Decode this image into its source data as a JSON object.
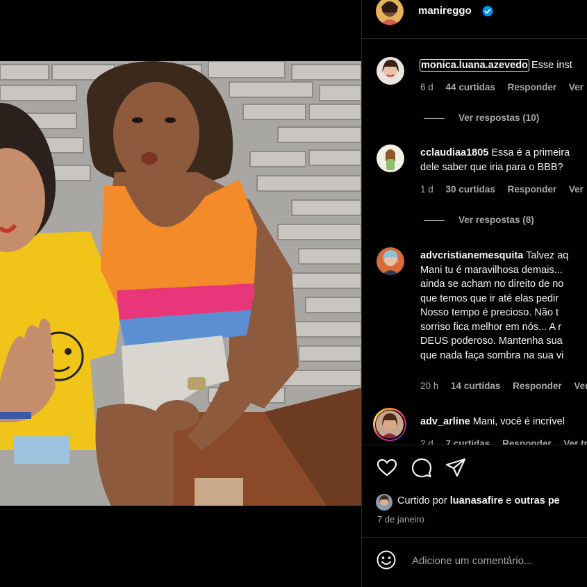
{
  "post": {
    "author": "manireggo",
    "verified": true,
    "likes_prefix": "Curtido por",
    "liked_by": "luanasafire",
    "likes_joiner": "e",
    "likes_others": "outras pe",
    "date": "7 de janeiro"
  },
  "comments": [
    {
      "username": "monica.luana.azevedo",
      "lines": [
        "Esse inst"
      ],
      "time": "6 d",
      "likes": "44 curtidas",
      "reply": "Responder",
      "more": "Ver",
      "view_replies": "Ver respostas (10)"
    },
    {
      "username": "cclaudiaa1805",
      "lines": [
        "Essa é a primeira",
        "dele saber que iria para o BBB?"
      ],
      "time": "1 d",
      "likes": "30 curtidas",
      "reply": "Responder",
      "more": "Ver",
      "view_replies": "Ver respostas (8)"
    },
    {
      "username": "advcristianemesquita",
      "lines": [
        "Talvez aq",
        "Mani tu é maravilhosa demais...",
        "ainda se acham no direito de no",
        "que temos que ir até elas pedir",
        "Nosso tempo é precioso. Não t",
        "sorriso fica melhor em nós... A r",
        "DEUS poderoso. Mantenha sua",
        "que nada faça sombra na sua vi"
      ],
      "time": "20 h",
      "likes": "14 curtidas",
      "reply": "Responder",
      "more": "Ver"
    },
    {
      "username": "adv_arline",
      "lines": [
        "Mani, você é incrível"
      ],
      "time": "2 d",
      "likes": "7 curtidas",
      "reply": "Responder",
      "more": "Ver tr"
    }
  ],
  "comment_box": {
    "placeholder": "Adicione um comentário..."
  },
  "icons": {
    "like": "heart-icon",
    "comment": "comment-bubble-icon",
    "share": "paper-plane-icon",
    "emoji": "smiley-icon",
    "verified": "verified-badge-icon"
  },
  "colors": {
    "background": "#000000",
    "text": "#f5f5f5",
    "secondary_text": "#a8a8a8",
    "divider": "#262626",
    "verified_blue": "#0095f6"
  }
}
